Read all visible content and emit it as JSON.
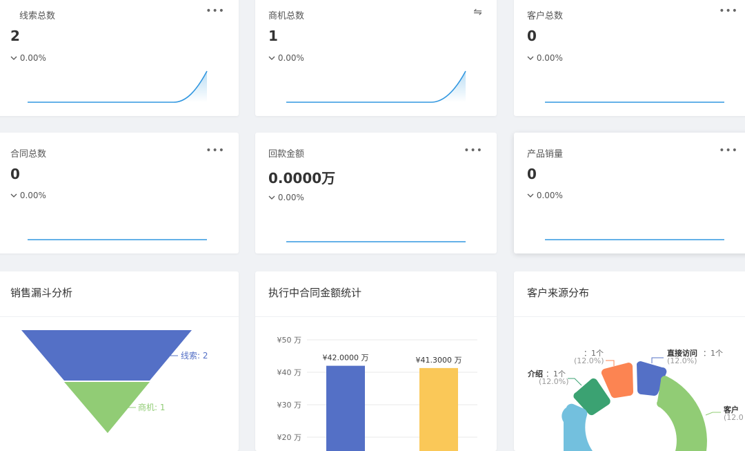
{
  "stats": [
    {
      "title": "线索总数",
      "value": "2",
      "change": "0.00%",
      "action": "more"
    },
    {
      "title": "商机总数",
      "value": "1",
      "change": "0.00%",
      "action": "swap"
    },
    {
      "title": "客户总数",
      "value": "0",
      "change": "0.00%",
      "action": "more"
    },
    {
      "title": "合同总数",
      "value": "0",
      "change": "0.00%",
      "action": "more"
    },
    {
      "title": "回款金额",
      "value": "0.0000万",
      "change": "0.00%",
      "action": "more"
    },
    {
      "title": "产品销量",
      "value": "0",
      "change": "0.00%",
      "action": "more"
    }
  ],
  "icons": {
    "more": "•••",
    "swap": "⇋",
    "trend": "chevron-down-icon"
  },
  "funnel": {
    "title": "销售漏斗分析",
    "stages": [
      {
        "label": "线索: 2",
        "color": "#5470c6"
      },
      {
        "label": "商机: 1",
        "color": "#91cc75"
      }
    ]
  },
  "bar_card": {
    "title": "执行中合同金额统计"
  },
  "pie_card": {
    "title": "客户来源分布"
  },
  "chart_data": [
    {
      "type": "bar",
      "title": "执行中合同金额统计",
      "categories": [
        "",
        ""
      ],
      "values": [
        42.0,
        41.3
      ],
      "value_labels": [
        "¥42.0000 万",
        "¥41.3000 万"
      ],
      "colors": [
        "#5470c6",
        "#fac858"
      ],
      "ylim": [
        20,
        50
      ],
      "ytick_labels": [
        "¥50 万",
        "¥40 万",
        "¥30 万",
        "¥20 万"
      ]
    },
    {
      "type": "pie",
      "title": "客户来源分布",
      "slices": [
        {
          "name": "直接访问",
          "value": 1,
          "percent": "12.0%",
          "color": "#5470c6"
        },
        {
          "name": "",
          "value": 1,
          "percent": "12.0%",
          "color": "#fc8452"
        },
        {
          "name": "介绍",
          "value": 1,
          "percent": "12.0%",
          "color": "#3ba272"
        },
        {
          "name": "",
          "value": 1,
          "percent": "",
          "color": "#73c0de"
        },
        {
          "name": "客户",
          "value": 1,
          "percent": "12.0",
          "color": "#91cc75"
        }
      ],
      "labels": {
        "direct": "直接访问",
        "direct_count": "1个",
        "direct_pct": "(12.0%)",
        "orange_count": "1个",
        "orange_pct": "(12.0%)",
        "green_name": "介绍",
        "green_count": "1个",
        "green_pct": "(12.0%)",
        "right_name": "客户",
        "right_pct": "(12.0"
      }
    }
  ]
}
